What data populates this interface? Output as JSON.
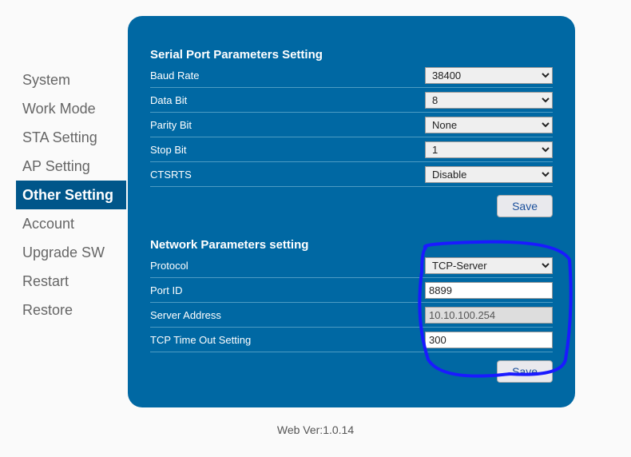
{
  "sidebar": {
    "items": [
      {
        "label": "System"
      },
      {
        "label": "Work Mode"
      },
      {
        "label": "STA Setting"
      },
      {
        "label": "AP Setting"
      },
      {
        "label": "Other Setting",
        "active": true
      },
      {
        "label": "Account"
      },
      {
        "label": "Upgrade SW"
      },
      {
        "label": "Restart"
      },
      {
        "label": "Restore"
      }
    ]
  },
  "serial": {
    "title": "Serial Port Parameters Setting",
    "baud_label": "Baud Rate",
    "baud_value": "38400",
    "databit_label": "Data Bit",
    "databit_value": "8",
    "parity_label": "Parity Bit",
    "parity_value": "None",
    "stopbit_label": "Stop Bit",
    "stopbit_value": "1",
    "ctsrts_label": "CTSRTS",
    "ctsrts_value": "Disable",
    "save_label": "Save"
  },
  "network": {
    "title": "Network Parameters setting",
    "protocol_label": "Protocol",
    "protocol_value": "TCP-Server",
    "portid_label": "Port ID",
    "portid_value": "8899",
    "server_label": "Server Address",
    "server_value": "10.10.100.254",
    "timeout_label": "TCP Time Out Setting",
    "timeout_value": "300",
    "save_label": "Save"
  },
  "footer": {
    "version": "Web Ver:1.0.14"
  },
  "annotation": {
    "color": "#1a1aff"
  }
}
